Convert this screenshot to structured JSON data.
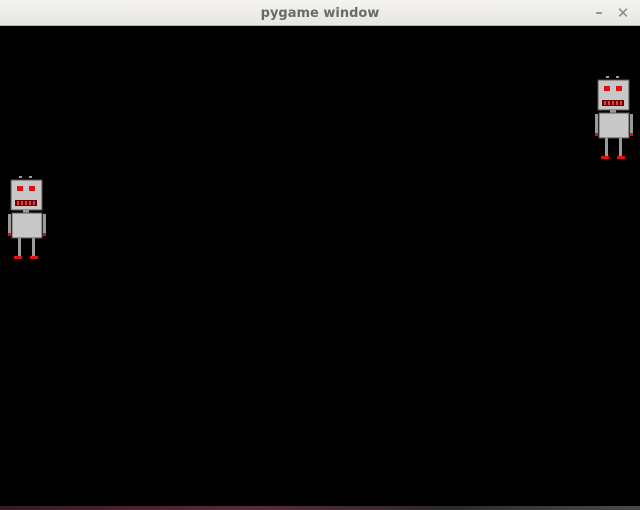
{
  "window": {
    "title": "pygame window",
    "minimize_glyph": "–",
    "close_glyph": "✕"
  },
  "game": {
    "background_color": "#000000",
    "sprites": [
      {
        "name": "robot",
        "body_color": "#c8c8c8",
        "eye_color": "#e01010",
        "foot_color": "#e01010"
      },
      {
        "name": "robot",
        "body_color": "#c8c8c8",
        "eye_color": "#e01010",
        "foot_color": "#e01010"
      }
    ]
  }
}
